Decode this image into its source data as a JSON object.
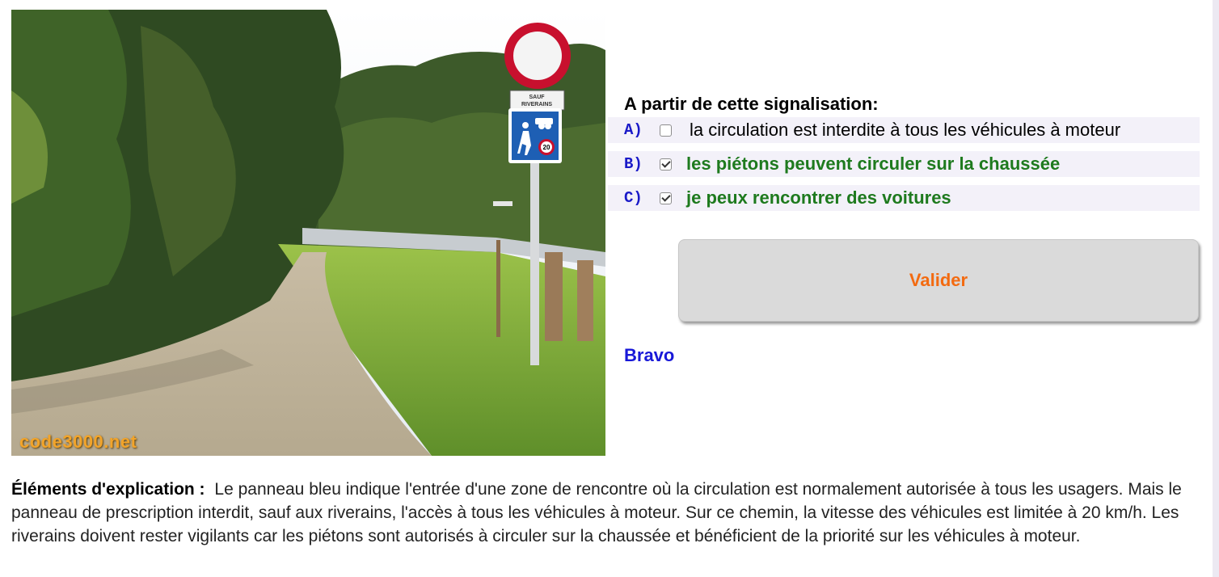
{
  "photo": {
    "watermark": "code3000.net",
    "sign_plate_text_1": "SAUF",
    "sign_plate_text_2": "RIVERAINS",
    "speed_limit": "20"
  },
  "question": {
    "title": "A partir de cette signalisation:",
    "answers": [
      {
        "letter": "A)",
        "text": "la circulation est interdite à tous les véhicules à moteur",
        "checked": false
      },
      {
        "letter": "B)",
        "text": "les piétons peuvent circuler sur la chaussée",
        "checked": true
      },
      {
        "letter": "C)",
        "text": "je peux rencontrer des voitures",
        "checked": true
      }
    ]
  },
  "validate_label": "Valider",
  "result_text": "Bravo",
  "explanation": {
    "lead": "Éléments d'explication :",
    "body": "Le panneau bleu indique l'entrée d'une zone de rencontre où la circulation est normalement autorisée à tous les usagers. Mais le panneau de prescription interdit, sauf aux riverains, l'accès à tous les véhicules à moteur. Sur ce chemin, la vitesse des véhicules est limitée à 20 km/h. Les riverains doivent rester vigilants car les piétons sont autorisés à circuler sur la chaussée et bénéficient de la priorité sur les véhicules à moteur."
  },
  "colors": {
    "answer_letter": "#1a1ac8",
    "selected_answer": "#1e7a1e",
    "validate_text": "#f36a10",
    "result": "#1818d8",
    "answer_row_bg": "#f3f1f9"
  },
  "icons": [
    "no-entry-sign-icon",
    "meeting-zone-sign-icon",
    "speed-limit-icon"
  ]
}
